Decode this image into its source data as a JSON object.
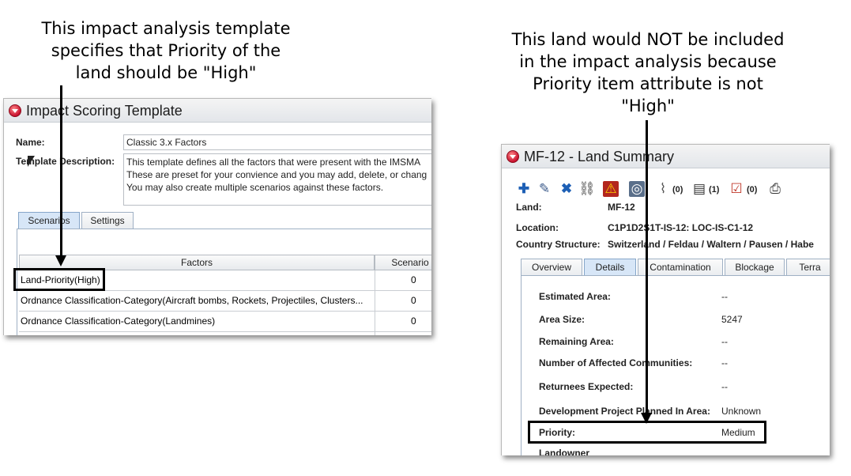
{
  "annotations": {
    "left_caption": [
      "This impact analysis template",
      "specifies that Priority of the",
      "land should be \"High\""
    ],
    "right_caption": [
      "This land would NOT be included",
      "in the impact analysis because",
      "Priority item attribute is not",
      "\"High\""
    ]
  },
  "scoring_template": {
    "title": "Impact Scoring Template",
    "name_label": "Name:",
    "name_value": "Classic 3.x Factors",
    "description_label": "Template Description:",
    "description_lines": [
      "This template defines all the factors that were present with the IMSMA",
      "These are preset for your convience and you may add, delete, or chang",
      "You may also create multiple scenarios against these factors."
    ],
    "tabs": [
      {
        "label": "Scenarios",
        "active": true
      },
      {
        "label": "Settings",
        "active": false
      }
    ],
    "columns": {
      "factors": "Factors",
      "scenario": "Scenario"
    },
    "rows": [
      {
        "factor": "Land-Priority(High)",
        "score": "0"
      },
      {
        "factor": "Ordnance Classification-Category(Aircraft bombs, Rockets, Projectiles, Clusters...",
        "score": "0"
      },
      {
        "factor": "Ordnance Classification-Category(Landmines)",
        "score": "0"
      }
    ]
  },
  "land_summary": {
    "title": "MF-12 - Land Summary",
    "toolbar": {
      "icons": [
        "plus-icon",
        "pencil-icon",
        "delete-x-icon",
        "link-icon",
        "hazard-icon",
        "glasses-icon",
        "paperclip-icon",
        "document-icon",
        "checklist-icon",
        "printer-icon"
      ],
      "attachments_count": "(0)",
      "documents_count": "(1)",
      "tasks_count": "(0)"
    },
    "land_label": "Land:",
    "land_value": "MF-12",
    "location_label": "Location:",
    "location_value": "C1P1D2S1T-IS-12: LOC-IS-C1-12",
    "country_label": "Country Structure:",
    "country_value": "Switzerland / Feldau / Waltern / Pausen / Habe",
    "tabs": [
      {
        "label": "Overview",
        "active": false
      },
      {
        "label": "Details",
        "active": true
      },
      {
        "label": "Contamination",
        "active": false
      },
      {
        "label": "Blockage",
        "active": false
      },
      {
        "label": "Terra",
        "active": false
      }
    ],
    "details": [
      {
        "label": "Estimated Area:",
        "value": "--"
      },
      {
        "label": "Area Size:",
        "value": "5247"
      },
      {
        "label": "Remaining Area:",
        "value": "--"
      },
      {
        "label": "Number of Affected Communities:",
        "value": "--"
      },
      {
        "label": "Returnees Expected:",
        "value": "--"
      },
      {
        "label": "Development Project Planned In Area:",
        "value": "Unknown"
      },
      {
        "label": "Priority:",
        "value": "Medium"
      },
      {
        "label": "Landowner",
        "value": ""
      }
    ]
  }
}
